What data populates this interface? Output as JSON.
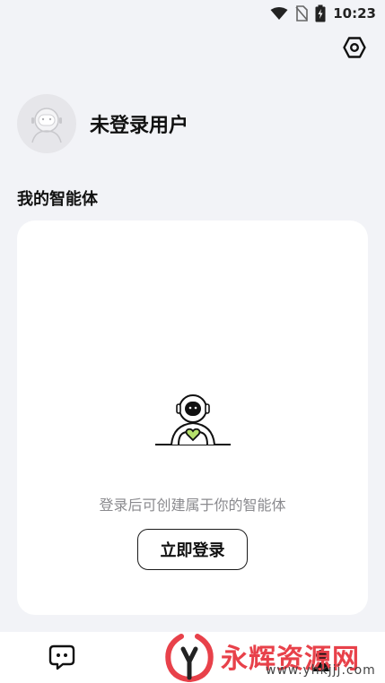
{
  "status_bar": {
    "time": "10:23",
    "icons": [
      "wifi-icon",
      "no-sim-icon",
      "battery-charging-icon"
    ]
  },
  "header": {
    "settings_icon": "settings-hexagon-icon"
  },
  "profile": {
    "avatar_icon": "robot-avatar-icon",
    "username": "未登录用户"
  },
  "section": {
    "title": "我的智能体"
  },
  "empty_state": {
    "illustration": "astronaut-heart-mascot",
    "message": "登录后可创建属于你的智能体",
    "login_button": "立即登录"
  },
  "bottom_nav": {
    "items": [
      "chat-icon",
      "profile-icon"
    ]
  },
  "watermark": {
    "text": "永辉资源网",
    "url": "www.yhkjjj.com"
  },
  "colors": {
    "background": "#f2f3f7",
    "card": "#ffffff",
    "heart_green": "#b5e06b",
    "watermark_red": "#e8414a"
  }
}
